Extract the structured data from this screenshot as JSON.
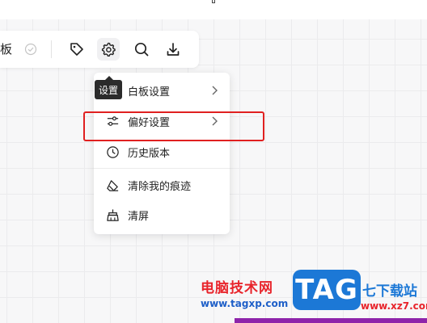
{
  "toolbar": {
    "board_label": "板",
    "tools": [
      {
        "name": "tag-icon"
      },
      {
        "name": "settings-gear-icon"
      },
      {
        "name": "search-icon"
      },
      {
        "name": "download-icon"
      }
    ]
  },
  "tooltip": {
    "text": "设置"
  },
  "menu": {
    "items": [
      {
        "label": "白板设置",
        "icon": "whiteboard-icon",
        "has_submenu": true
      },
      {
        "label": "偏好设置",
        "icon": "sliders-icon",
        "has_submenu": true
      },
      {
        "label": "历史版本",
        "icon": "clock-icon",
        "has_submenu": false
      },
      {
        "label": "清除我的痕迹",
        "icon": "eraser-icon",
        "has_submenu": false
      },
      {
        "label": "清屏",
        "icon": "broom-icon",
        "has_submenu": false
      }
    ]
  },
  "watermark": {
    "cn_text": "电脑技术网",
    "url": "www.tagxp.com",
    "logo_text": "TAG",
    "right_text": "七下载站",
    "right_url": "www.xz7.com"
  },
  "colors": {
    "highlight": "#e02020",
    "logo_bg": "#1c78d6",
    "accent_purple": "#8e24aa"
  }
}
